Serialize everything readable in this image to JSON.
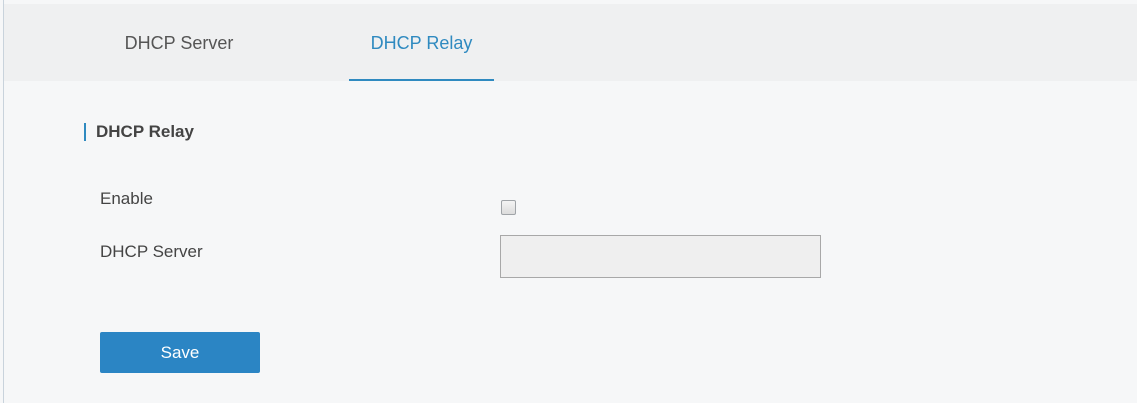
{
  "tabs": [
    {
      "label": "DHCP Server",
      "active": false
    },
    {
      "label": "DHCP Relay",
      "active": true
    }
  ],
  "section": {
    "title": "DHCP Relay"
  },
  "form": {
    "enable_label": "Enable",
    "enable_checked": false,
    "server_label": "DHCP Server",
    "server_value": "",
    "server_placeholder": ""
  },
  "buttons": {
    "save_label": "Save"
  },
  "colors": {
    "accent": "#2f8ac0",
    "button": "#2b85c4",
    "background": "#f6f7f8",
    "tabbar": "#eff0f1"
  }
}
